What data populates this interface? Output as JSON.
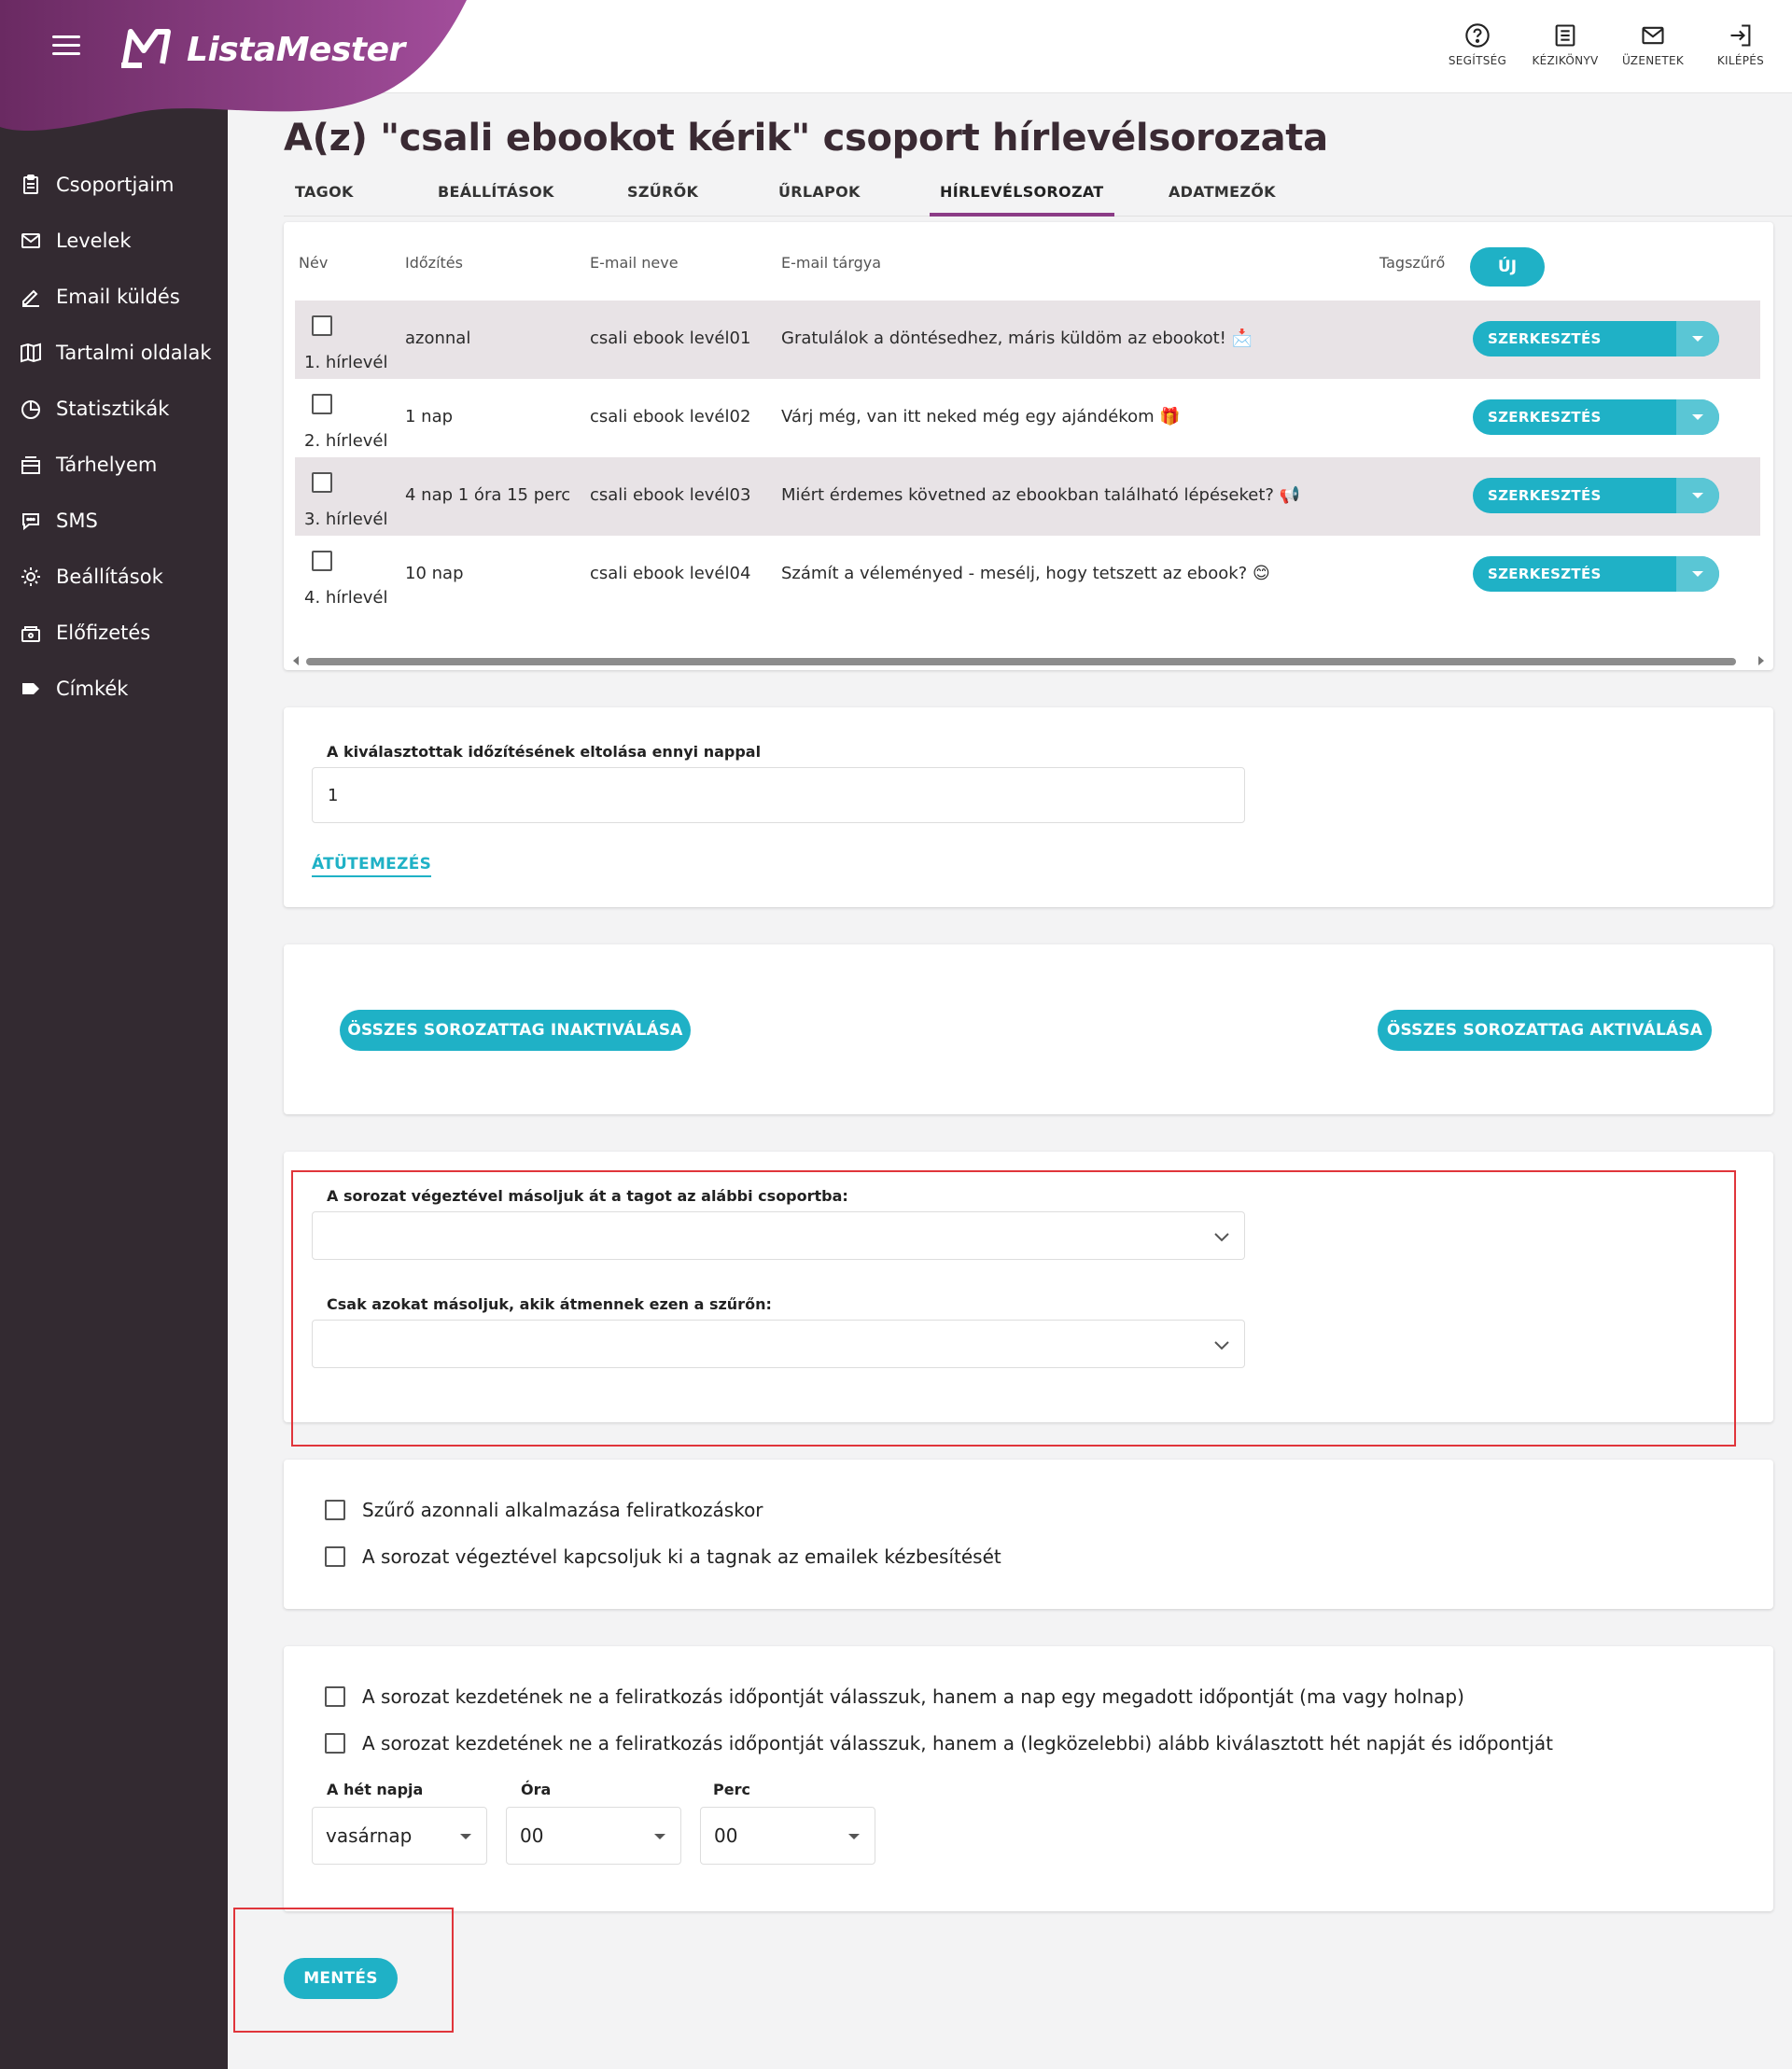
{
  "brand": {
    "name": "ListaMester"
  },
  "topbar": [
    {
      "icon": "help-icon",
      "label": "SEGÍTSÉG"
    },
    {
      "icon": "manual-icon",
      "label": "KÉZIKÖNYV"
    },
    {
      "icon": "mail-icon",
      "label": "ÜZENETEK"
    },
    {
      "icon": "logout-icon",
      "label": "KILÉPÉS"
    }
  ],
  "sidebar": {
    "items": [
      {
        "icon": "clipboard-icon",
        "label": "Csoportjaim"
      },
      {
        "icon": "envelope-icon",
        "label": "Levelek"
      },
      {
        "icon": "pencil-icon",
        "label": "Email küldés"
      },
      {
        "icon": "book-icon",
        "label": "Tartalmi oldalak"
      },
      {
        "icon": "pie-chart-icon",
        "label": "Statisztikák"
      },
      {
        "icon": "storage-icon",
        "label": "Tárhelyem"
      },
      {
        "icon": "chat-icon",
        "label": "SMS"
      },
      {
        "icon": "gear-icon",
        "label": "Beállítások"
      },
      {
        "icon": "subscription-icon",
        "label": "Előfizetés"
      },
      {
        "icon": "tag-icon",
        "label": "Címkék"
      }
    ]
  },
  "page": {
    "title": "A(z) \"csali ebookot kérik\" csoport hírlevélsorozata"
  },
  "tabs": [
    "TAGOK",
    "BEÁLLÍTÁSOK",
    "SZŰRŐK",
    "ŰRLAPOK",
    "HÍRLEVÉLSOROZAT",
    "ADATMEZŐK"
  ],
  "active_tab": "HÍRLEVÉLSOROZAT",
  "table": {
    "headers": {
      "name": "Név",
      "timing": "Időzítés",
      "email_name": "E-mail neve",
      "subject": "E-mail tárgya",
      "filter": "Tagszűrő"
    },
    "new_button": "ÚJ",
    "edit_label": "SZERKESZTÉS",
    "rows": [
      {
        "name": "1. hírlevél",
        "timing": "azonnal",
        "email_name": "csali ebook levél01",
        "subject": "Gratulálok a döntésedhez, máris küldöm az ebookot! 📩"
      },
      {
        "name": "2. hírlevél",
        "timing": "1 nap",
        "email_name": "csali ebook levél02",
        "subject": "Várj még, van itt neked még egy ajándékom 🎁"
      },
      {
        "name": "3. hírlevél",
        "timing": "4 nap 1 óra 15 perc",
        "email_name": "csali ebook levél03",
        "subject": "Miért érdemes követned az ebookban található lépéseket? 📢"
      },
      {
        "name": "4. hírlevél",
        "timing": "10 nap",
        "email_name": "csali ebook levél04",
        "subject": "Számít a véleményed - mesélj, hogy tetszett az ebook? 😊"
      }
    ]
  },
  "shift": {
    "label": "A kiválasztottak időzítésének eltolása ennyi nappal",
    "value": "1",
    "button": "ÁTÜTEMEZÉS"
  },
  "bulk": {
    "deactivate": "ÖSSZES SOROZATTAG INAKTIVÁLÁSA",
    "activate": "ÖSSZES SOROZATTAG AKTIVÁLÁSA"
  },
  "copy": {
    "group_label": "A sorozat végeztével másoljuk át a tagot az alábbi csoportba:",
    "filter_label": "Csak azokat másoljuk, akik átmennek ezen a szűrőn:"
  },
  "options": {
    "apply_filter": "Szűrő azonnali alkalmazása feliratkozáskor",
    "disable_delivery": "A sorozat végeztével kapcsoljuk ki a tagnak az emailek kézbesítését"
  },
  "schedule": {
    "opt_time": "A sorozat kezdetének ne a feliratkozás időpontját válasszuk, hanem a nap egy megadott időpontját (ma vagy holnap)",
    "opt_weekday": "A sorozat kezdetének ne a feliratkozás időpontját válasszuk, hanem a (legközelebbi) alább kiválasztott hét napját és időpontját",
    "day_label": "A hét napja",
    "day_value": "vasárnap",
    "hour_label": "Óra",
    "hour_value": "00",
    "minute_label": "Perc",
    "minute_value": "00"
  },
  "save_button": "MENTÉS",
  "colors": {
    "accent": "#1fb1c6",
    "brand": "#8b3c86",
    "sidebar": "#332a31",
    "highlight": "#e0353b"
  }
}
